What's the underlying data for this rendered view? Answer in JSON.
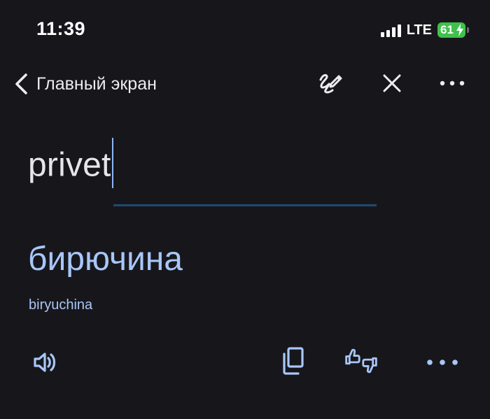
{
  "status_bar": {
    "time": "11:39",
    "network": "LTE",
    "battery": "61"
  },
  "toolbar": {
    "back_label": "Главный экран",
    "icons": [
      "chevron-left-icon",
      "handwriting-icon",
      "close-icon",
      "more-horizontal-icon"
    ]
  },
  "input": {
    "value": "privet"
  },
  "result": {
    "translation": "бирючина",
    "transliteration": "biryuchina"
  },
  "actions": {
    "icons": [
      "speaker-icon",
      "copy-icon",
      "feedback-icon",
      "more-horizontal-icon"
    ]
  },
  "colors": {
    "background": "#17171b",
    "accent": "#a9c6f9",
    "divider": "#1d4c72",
    "battery": "#3fc14b"
  }
}
